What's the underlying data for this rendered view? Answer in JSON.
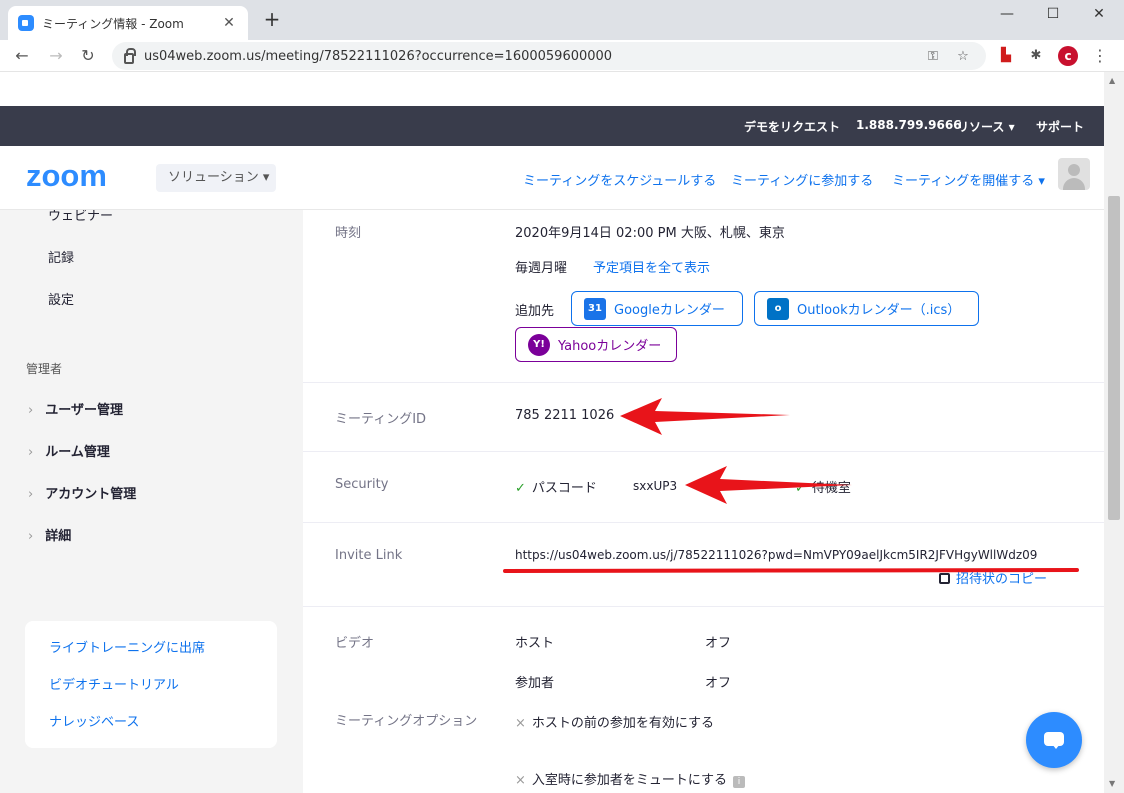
{
  "browser": {
    "tab_title": "ミーティング情報 - Zoom",
    "tab_close": "✕",
    "new_tab": "+",
    "url": "us04web.zoom.us/meeting/78522111026?occurrence=1600059600000",
    "back": "←",
    "forward": "→",
    "reload": "↻",
    "minimize": "—",
    "maximize": "☐",
    "close": "✕",
    "key_icon": "⚿",
    "star_icon": "☆",
    "extensions_icon": "✱",
    "menu_icon": "⋮"
  },
  "topbar": {
    "demo": "デモをリクエスト",
    "phone": "1.888.799.9666",
    "resources": "リソース ▾",
    "support": "サポート"
  },
  "header": {
    "solutions": "ソリューション ▾",
    "schedule": "ミーティングをスケジュールする",
    "join": "ミーティングに参加する",
    "host": "ミーティングを開催する ▾"
  },
  "sidebar": {
    "webinar": "ウェビナー",
    "recording": "記録",
    "settings": "設定",
    "admin_section": "管理者",
    "admin_items": [
      {
        "label": "ユーザー管理"
      },
      {
        "label": "ルーム管理"
      },
      {
        "label": "アカウント管理"
      },
      {
        "label": "詳細"
      }
    ],
    "chevron": "›",
    "help_links": [
      "ライブトレーニングに出席",
      "ビデオチュートリアル",
      "ナレッジベース"
    ]
  },
  "meeting": {
    "time_label": "時刻",
    "time_value": "2020年9月14日 02:00 PM 大阪、札幌、東京",
    "recurrence": "毎週月曜",
    "show_all": "予定項目を全て表示",
    "add_to": "追加先",
    "google_cal": "Googleカレンダー",
    "google_num": "31",
    "outlook_cal": "Outlookカレンダー（.ics）",
    "outlook_letter": "o",
    "yahoo_cal": "Yahooカレンダー",
    "yahoo_letter": "Y!",
    "id_label": "ミーティングID",
    "id_value": "785 2211 1026",
    "security_label": "Security",
    "passcode_label": "パスコード",
    "passcode_value": "sxxUP3",
    "waiting_room": "待機室",
    "invite_label": "Invite Link",
    "invite_url": "https://us04web.zoom.us/j/78522111026?pwd=NmVPY09aelJkcm5IR2JFVHgyWllWdz09",
    "copy_invite": "招待状のコピー",
    "video_label": "ビデオ",
    "host_label": "ホスト",
    "host_value": "オフ",
    "participants_label": "参加者",
    "participants_value": "オフ",
    "options_label": "ミーティングオプション",
    "option_join_before_host": "ホストの前の参加を有効にする",
    "option_mute_on_entry": "入室時に参加者をミュートにする",
    "check_icon": "✓",
    "x_icon": "×",
    "info_icon": "i"
  },
  "colors": {
    "zoom_blue": "#0e72ed",
    "topbar_dark": "#393c4b",
    "annotation_red": "#e8141a",
    "yahoo_purple": "#7b0099"
  }
}
